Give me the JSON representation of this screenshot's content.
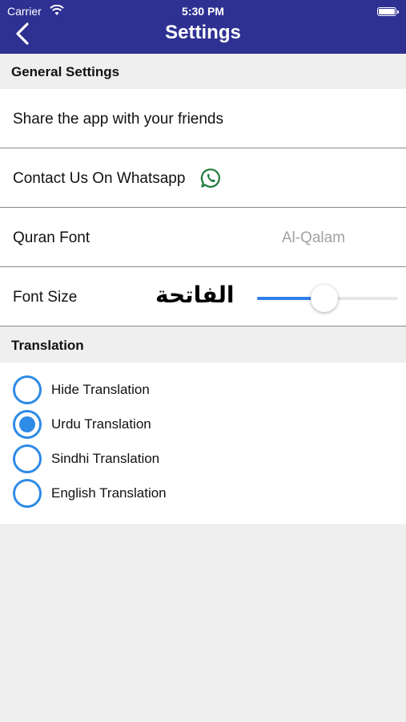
{
  "status_bar": {
    "carrier": "Carrier",
    "time": "5:30 PM"
  },
  "nav": {
    "title": "Settings",
    "back_icon": "chevron-left-icon"
  },
  "general": {
    "header": "General Settings",
    "share_label": "Share the app with your friends",
    "contact_label": "Contact Us On Whatsapp",
    "quran_font_label": "Quran Font",
    "quran_font_value": "Al-Qalam",
    "font_size_label": "Font Size",
    "font_sample": "الفاتحة",
    "font_size_slider": 0.48
  },
  "translation": {
    "header": "Translation",
    "options": [
      {
        "label": "Hide Translation",
        "selected": false
      },
      {
        "label": "Urdu Translation",
        "selected": true
      },
      {
        "label": "Sindhi Translation",
        "selected": false
      },
      {
        "label": "English Translation",
        "selected": false
      }
    ]
  },
  "colors": {
    "nav_bg": "#2e3192",
    "accent": "#2e8be6",
    "whatsapp": "#1f7a3a"
  }
}
